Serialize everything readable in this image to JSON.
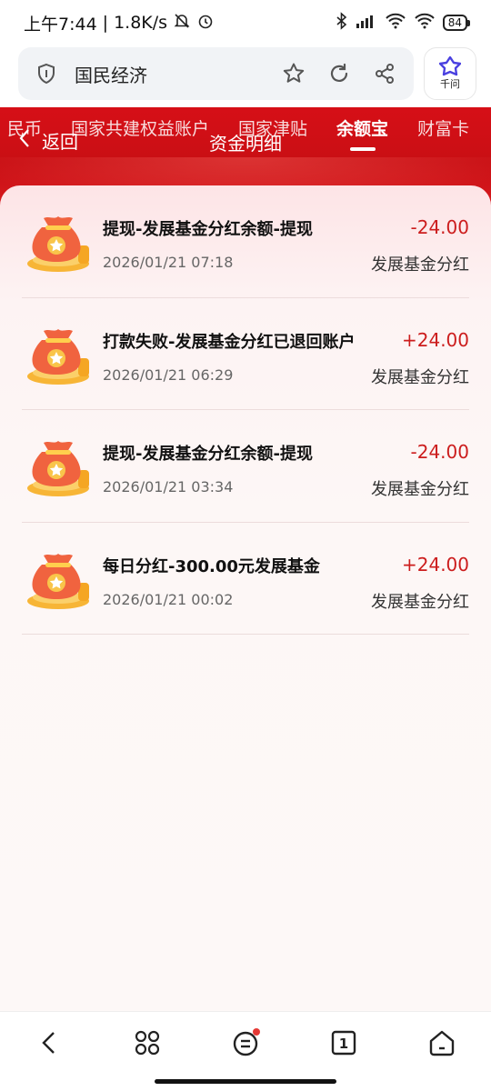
{
  "status_bar": {
    "time": "上午7:44",
    "speed": "1.8K/s",
    "battery": "84"
  },
  "address_bar": {
    "title": "国民经济",
    "assistant_label": "千问"
  },
  "tabs": [
    {
      "label": "民币"
    },
    {
      "label": "国家共建权益账户"
    },
    {
      "label": "国家津贴"
    },
    {
      "label": "余额宝"
    },
    {
      "label": "财富卡"
    }
  ],
  "header": {
    "back_label": "返回",
    "title": "资金明细"
  },
  "transactions": [
    {
      "title": "提现-发展基金分红余额-提现",
      "time": "2026/01/21 07:18",
      "amount": "-24.00",
      "category": "发展基金分红"
    },
    {
      "title": "打款失败-发展基金分红已退回账户",
      "time": "2026/01/21 06:29",
      "amount": "+24.00",
      "category": "发展基金分红"
    },
    {
      "title": "提现-发展基金分红余额-提现",
      "time": "2026/01/21 03:34",
      "amount": "-24.00",
      "category": "发展基金分红"
    },
    {
      "title": "每日分红-300.00元发展基金",
      "time": "2026/01/21 00:02",
      "amount": "+24.00",
      "category": "发展基金分红"
    }
  ],
  "bottom_nav": {
    "tab_count": "1"
  },
  "colors": {
    "header_red": "#d60f17",
    "amount_red": "#cc1d1d",
    "assistant_blue": "#4a40e0"
  }
}
